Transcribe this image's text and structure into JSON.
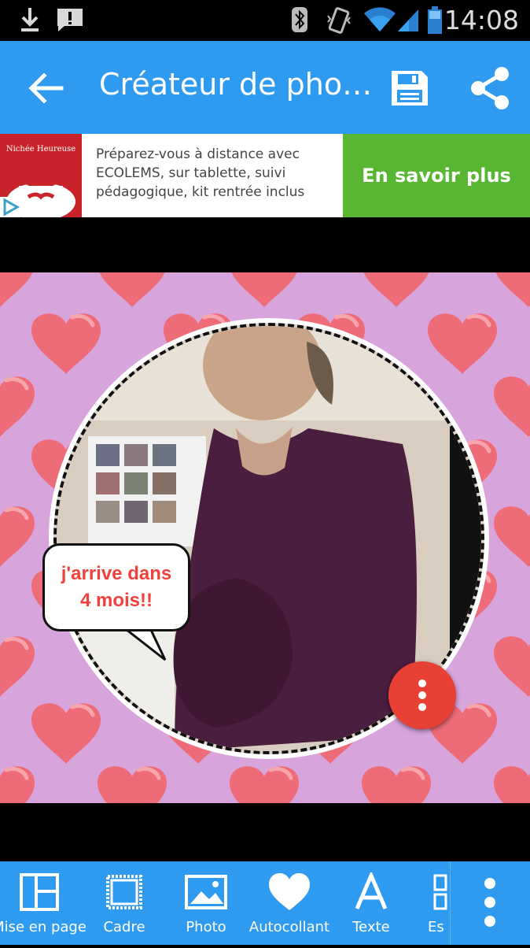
{
  "status_bar": {
    "time": "14:08",
    "icons": [
      "download-icon",
      "message-icon",
      "bluetooth-icon",
      "vibrate-icon",
      "wifi-icon",
      "signal-icon",
      "battery-icon"
    ]
  },
  "app_bar": {
    "title": "Créateur de pho…",
    "back_icon": "arrow-left-icon",
    "save_icon": "floppy-disk-icon",
    "share_icon": "share-icon"
  },
  "ad_banner": {
    "text": "Préparez-vous à distance avec ECOLEMS, sur tablette, suivi pédagogique, kit rentrée inclus",
    "cta": "En savoir plus",
    "thumb_text": "Nichée Heureuse"
  },
  "canvas": {
    "background_color": "#d7a4dc",
    "heart_color": "#ee6b78",
    "speech_bubble": {
      "line1": "j'arrive dans",
      "line2": "4 mois!!"
    },
    "fab_icon": "more-vertical-icon"
  },
  "bottom_toolbar": {
    "items": [
      {
        "label": "Mise en page",
        "icon": "layout-icon"
      },
      {
        "label": "Cadre",
        "icon": "frame-icon"
      },
      {
        "label": "Photo",
        "icon": "image-icon"
      },
      {
        "label": "Autocollant",
        "icon": "heart-icon"
      },
      {
        "label": "Texte",
        "icon": "text-icon"
      },
      {
        "label": "Es",
        "icon": "spacing-icon"
      }
    ],
    "more_icon": "more-vertical-icon"
  },
  "colors": {
    "accent": "#2f9bf0",
    "cta_green": "#58b632",
    "fab_red": "#e84034",
    "bubble_text": "#f2403c"
  }
}
